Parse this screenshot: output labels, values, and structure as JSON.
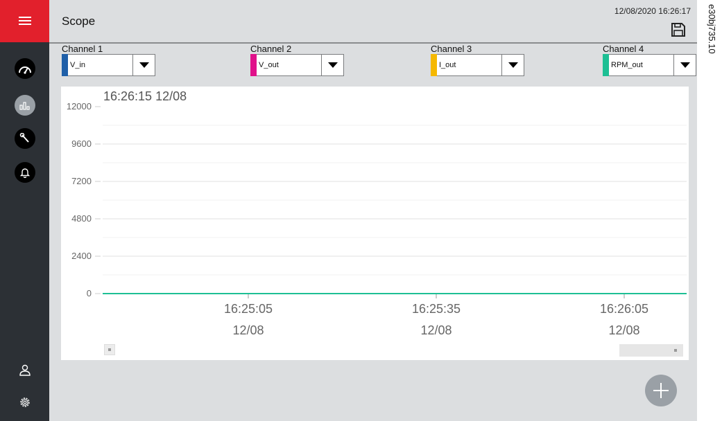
{
  "app": {
    "title": "Scope",
    "datetime": "12/08/2020 16:26:17",
    "figure_id": "e30bj735.10"
  },
  "sidebar": {
    "menu_icon": "hamburger-icon",
    "items": [
      {
        "icon": "dashboard-gauge-icon",
        "active": false
      },
      {
        "icon": "scope-chart-icon",
        "active": true
      },
      {
        "icon": "wrench-icon",
        "active": false
      },
      {
        "icon": "bell-icon",
        "active": false
      }
    ],
    "bottom_items": [
      {
        "icon": "user-icon"
      },
      {
        "icon": "gear-icon"
      }
    ]
  },
  "channels": [
    {
      "label": "Channel 1",
      "value": "V_in",
      "color": "#1f5fa8"
    },
    {
      "label": "Channel 2",
      "value": "V_out",
      "color": "#e0118a"
    },
    {
      "label": "Channel 3",
      "value": "I_out",
      "color": "#f5b800"
    },
    {
      "label": "Channel 4",
      "value": "RPM_out",
      "color": "#1dbf94"
    }
  ],
  "chart_data": {
    "type": "line",
    "title": "16:26:15 12/08",
    "y_ticks": [
      "12000",
      "9600",
      "7200",
      "4800",
      "2400",
      "0"
    ],
    "ylim": [
      0,
      12000
    ],
    "x_ticks": [
      {
        "time": "16:25:05",
        "date": "12/08"
      },
      {
        "time": "16:25:35",
        "date": "12/08"
      },
      {
        "time": "16:26:05",
        "date": "12/08"
      }
    ],
    "grid": true,
    "series": [
      {
        "name": "RPM_out",
        "color": "#1dbf94",
        "x": [
          "16:24:35",
          "16:26:15"
        ],
        "values": [
          0,
          0
        ]
      }
    ]
  },
  "controls": {
    "add_icon": "plus-icon",
    "save_icon": "save-floppy-icon"
  }
}
